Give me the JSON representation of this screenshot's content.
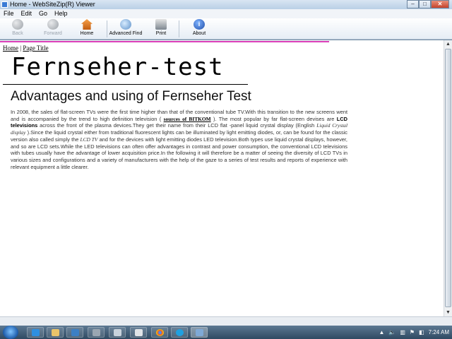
{
  "window": {
    "title": "Home - WebSiteZip(R) Viewer"
  },
  "menu": [
    "File",
    "Edit",
    "Go",
    "Help"
  ],
  "toolbar": {
    "back": "Back",
    "forward": "Forward",
    "home": "Home",
    "advanced_find": "Advanced Find",
    "print": "Print",
    "about": "About"
  },
  "page": {
    "breadcrumb": {
      "home": "Home",
      "separator": "|",
      "current": "Page Title"
    },
    "site_title": "Fernseher-test",
    "heading": "Advantages and using of Fernseher Test",
    "article": {
      "p1": "In 2008, the sales of flat-screen TVs were the first time higher than that of the conventional tube TV.With this transition to the new screens went and is accompanied by the trend to high definition television (",
      "cite": "sources of BITKOM",
      "p2": "). The most popular by far flat-screen devises are",
      "bold1": "LCD televisions",
      "p3": "across the front of the plasma devices.They get their name from their LCD flat -panel liquid crystal display (English",
      "italic1": "Liquid Crystal display",
      "p4": ").Since the liquid crystal either from traditional fluorescent lights can be illuminated by light emitting diodes, or, can be found for the classic version also called simply the",
      "italic2": "LCD TV",
      "p5": "and for the devices with light emitting diodes LED television.Both types use liquid crystal displays, however, and so are LCD sets.While the LED televisions can often offer advantages in contrast and power consumption, the conventional LCD televisions with tubes usually have the advantage of lower acquisition price.In the following it will therefore be a matter of seeing the diversity of LCD TVs in various sizes and configurations and a variety of manufacturers with the help of the gaze to a series of test results and reports of experience with relevant equipment a little clearer."
    }
  },
  "taskbar": {
    "clock": "7:24 AM"
  },
  "colors": {
    "accent_line": "#d83fb8",
    "taskbar": "#2f4a62"
  }
}
